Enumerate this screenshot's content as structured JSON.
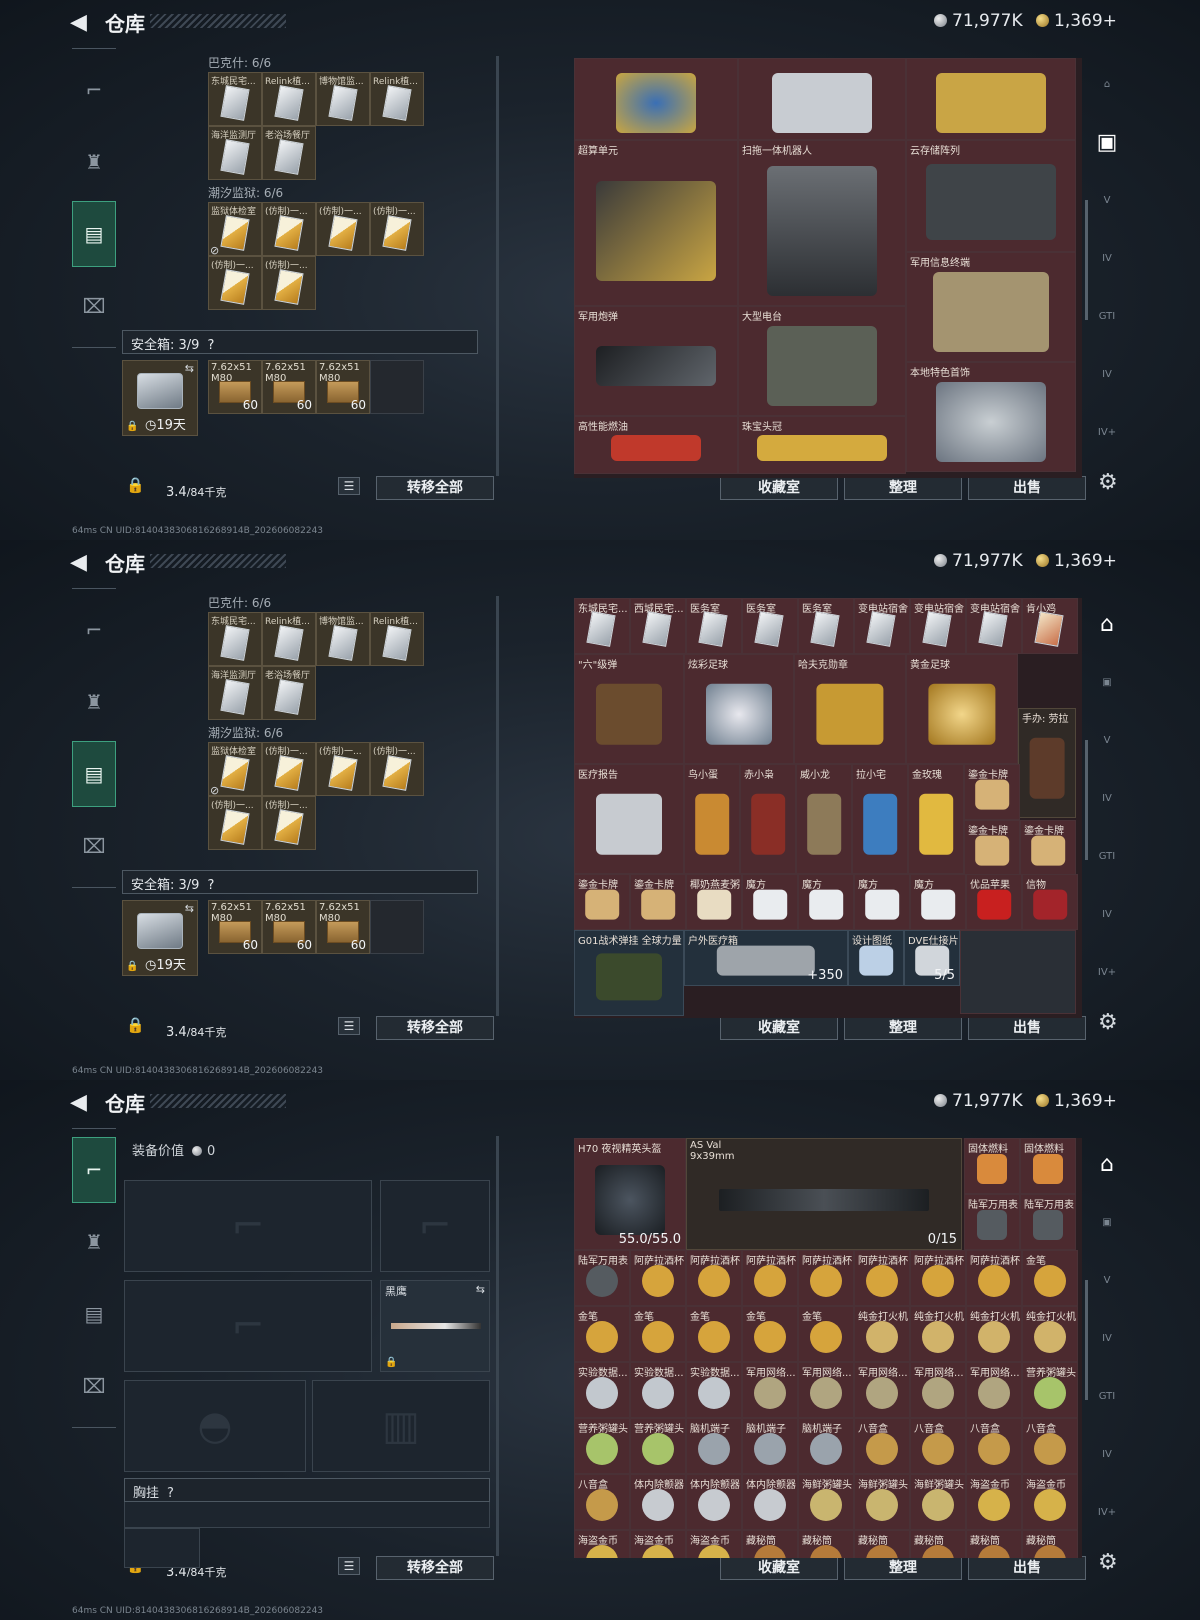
{
  "app": {
    "title": "仓库",
    "silver": "71,977K",
    "gold": "1,369",
    "plus": "+",
    "footer": "64ms    CN UID:8140438306816268914B_202606082243"
  },
  "labels": {
    "safebox": "安全箱: 3/9",
    "help": "?",
    "weight": "3.4",
    "weight_unit": "/84千克",
    "transfer_all": "转移全部",
    "collection": "收藏室",
    "sort": "整理",
    "sell": "出售",
    "days": "19天",
    "equip_value": "装备价值",
    "equip_value_num": "0",
    "chest_rig": "胸挂",
    "black_eagle": "黑鹰"
  },
  "left": {
    "header0": "巴克什: 6/6",
    "row1": [
      "东城民宅...",
      "Relink植...",
      "博物馆监...",
      "Relink植..."
    ],
    "row2": [
      "海洋监测厅",
      "老浴场餐厅"
    ],
    "header1": "潮汐监狱: 6/6",
    "row3": [
      "监狱体检室",
      "(仿制)一...",
      "(仿制)一...",
      "(仿制)一..."
    ],
    "row4": [
      "(仿制)一...",
      "(仿制)一..."
    ],
    "ammo": [
      {
        "name": "7.62x51 M80",
        "count": "60"
      },
      {
        "name": "7.62x51 M80",
        "count": "60"
      },
      {
        "name": "7.62x51 M80",
        "count": "60"
      }
    ]
  },
  "panel1": {
    "items": [
      {
        "label": "超算单元"
      },
      {
        "label": "扫拖一体机器人"
      },
      {
        "label": "云存储阵列"
      },
      {
        "label": "军用信息终端"
      },
      {
        "label": "军用炮弹"
      },
      {
        "label": "大型电台"
      },
      {
        "label": "本地特色首饰"
      },
      {
        "label": "高性能燃油"
      },
      {
        "label": "珠宝头冠"
      }
    ]
  },
  "panel2": {
    "top": [
      "东城民宅...",
      "西城民宅...",
      "医务室",
      "医务室",
      "医务室",
      "变电站宿舍",
      "变电站宿舍",
      "变电站宿舍",
      "肯小鸡"
    ],
    "items": [
      {
        "label": "\"六\"级弹"
      },
      {
        "label": "炫彩足球"
      },
      {
        "label": "哈夫克勋章"
      },
      {
        "label": "黄金足球"
      },
      {
        "label": "手办: 劳拉"
      },
      {
        "label": "医疗报告"
      },
      {
        "label": "鸟小蛋"
      },
      {
        "label": "赤小枭"
      },
      {
        "label": "威小龙"
      },
      {
        "label": "拉小宅"
      },
      {
        "label": "金玫瑰"
      },
      {
        "label": "鎏金卡牌"
      },
      {
        "label": "鎏金卡牌"
      },
      {
        "label": "鎏金卡牌"
      },
      {
        "label": "鎏金卡牌"
      },
      {
        "label": "鎏金卡牌"
      },
      {
        "label": "椰奶燕麦粥"
      },
      {
        "label": "魔方"
      },
      {
        "label": "魔方"
      },
      {
        "label": "魔方"
      },
      {
        "label": "魔方"
      },
      {
        "label": "优品苹果"
      },
      {
        "label": "信物"
      },
      {
        "label": "G01战术弹挂 全球力量"
      },
      {
        "label": "户外医疗箱",
        "count": "+350"
      },
      {
        "label": "设计图纸"
      },
      {
        "label": "DVE仕接片",
        "count": "5/5"
      }
    ]
  },
  "panel3": {
    "helmet": {
      "label": "H70 夜视精英头盔",
      "count": "55.0/55.0"
    },
    "gun": {
      "label": "AS Val",
      "sub": "9x39mm",
      "count": "0/15"
    },
    "small": [
      "固体燃料",
      "固体燃料",
      "陆军万用表",
      "陆军万用表"
    ],
    "grid": [
      [
        "陆军万用表",
        "阿萨拉酒杯",
        "阿萨拉酒杯",
        "阿萨拉酒杯",
        "阿萨拉酒杯",
        "阿萨拉酒杯",
        "阿萨拉酒杯",
        "阿萨拉酒杯",
        "金笔"
      ],
      [
        "金笔",
        "金笔",
        "金笔",
        "金笔",
        "金笔",
        "纯金打火机",
        "纯金打火机",
        "纯金打火机",
        "纯金打火机"
      ],
      [
        "实验数据...",
        "实验数据...",
        "实验数据...",
        "军用网络...",
        "军用网络...",
        "军用网络...",
        "军用网络...",
        "军用网络...",
        "营养粥罐头"
      ],
      [
        "营养粥罐头",
        "营养粥罐头",
        "脑机端子",
        "脑机端子",
        "脑机端子",
        "八音盒",
        "八音盒",
        "八音盒",
        "八音盒"
      ],
      [
        "八音盒",
        "体内除颤器",
        "体内除颤器",
        "体内除颤器",
        "海鲜粥罐头",
        "海鲜粥罐头",
        "海鲜粥罐头",
        "海盗金币",
        "海盗金币"
      ],
      [
        "海盗金币",
        "海盗金币",
        "海盗金币",
        "藏秘筒",
        "藏秘筒",
        "藏秘筒",
        "藏秘筒",
        "藏秘筒",
        "藏秘筒"
      ]
    ]
  },
  "colors": {
    "accent": "#3da07f",
    "collection_bg": "#4c2a2f"
  }
}
